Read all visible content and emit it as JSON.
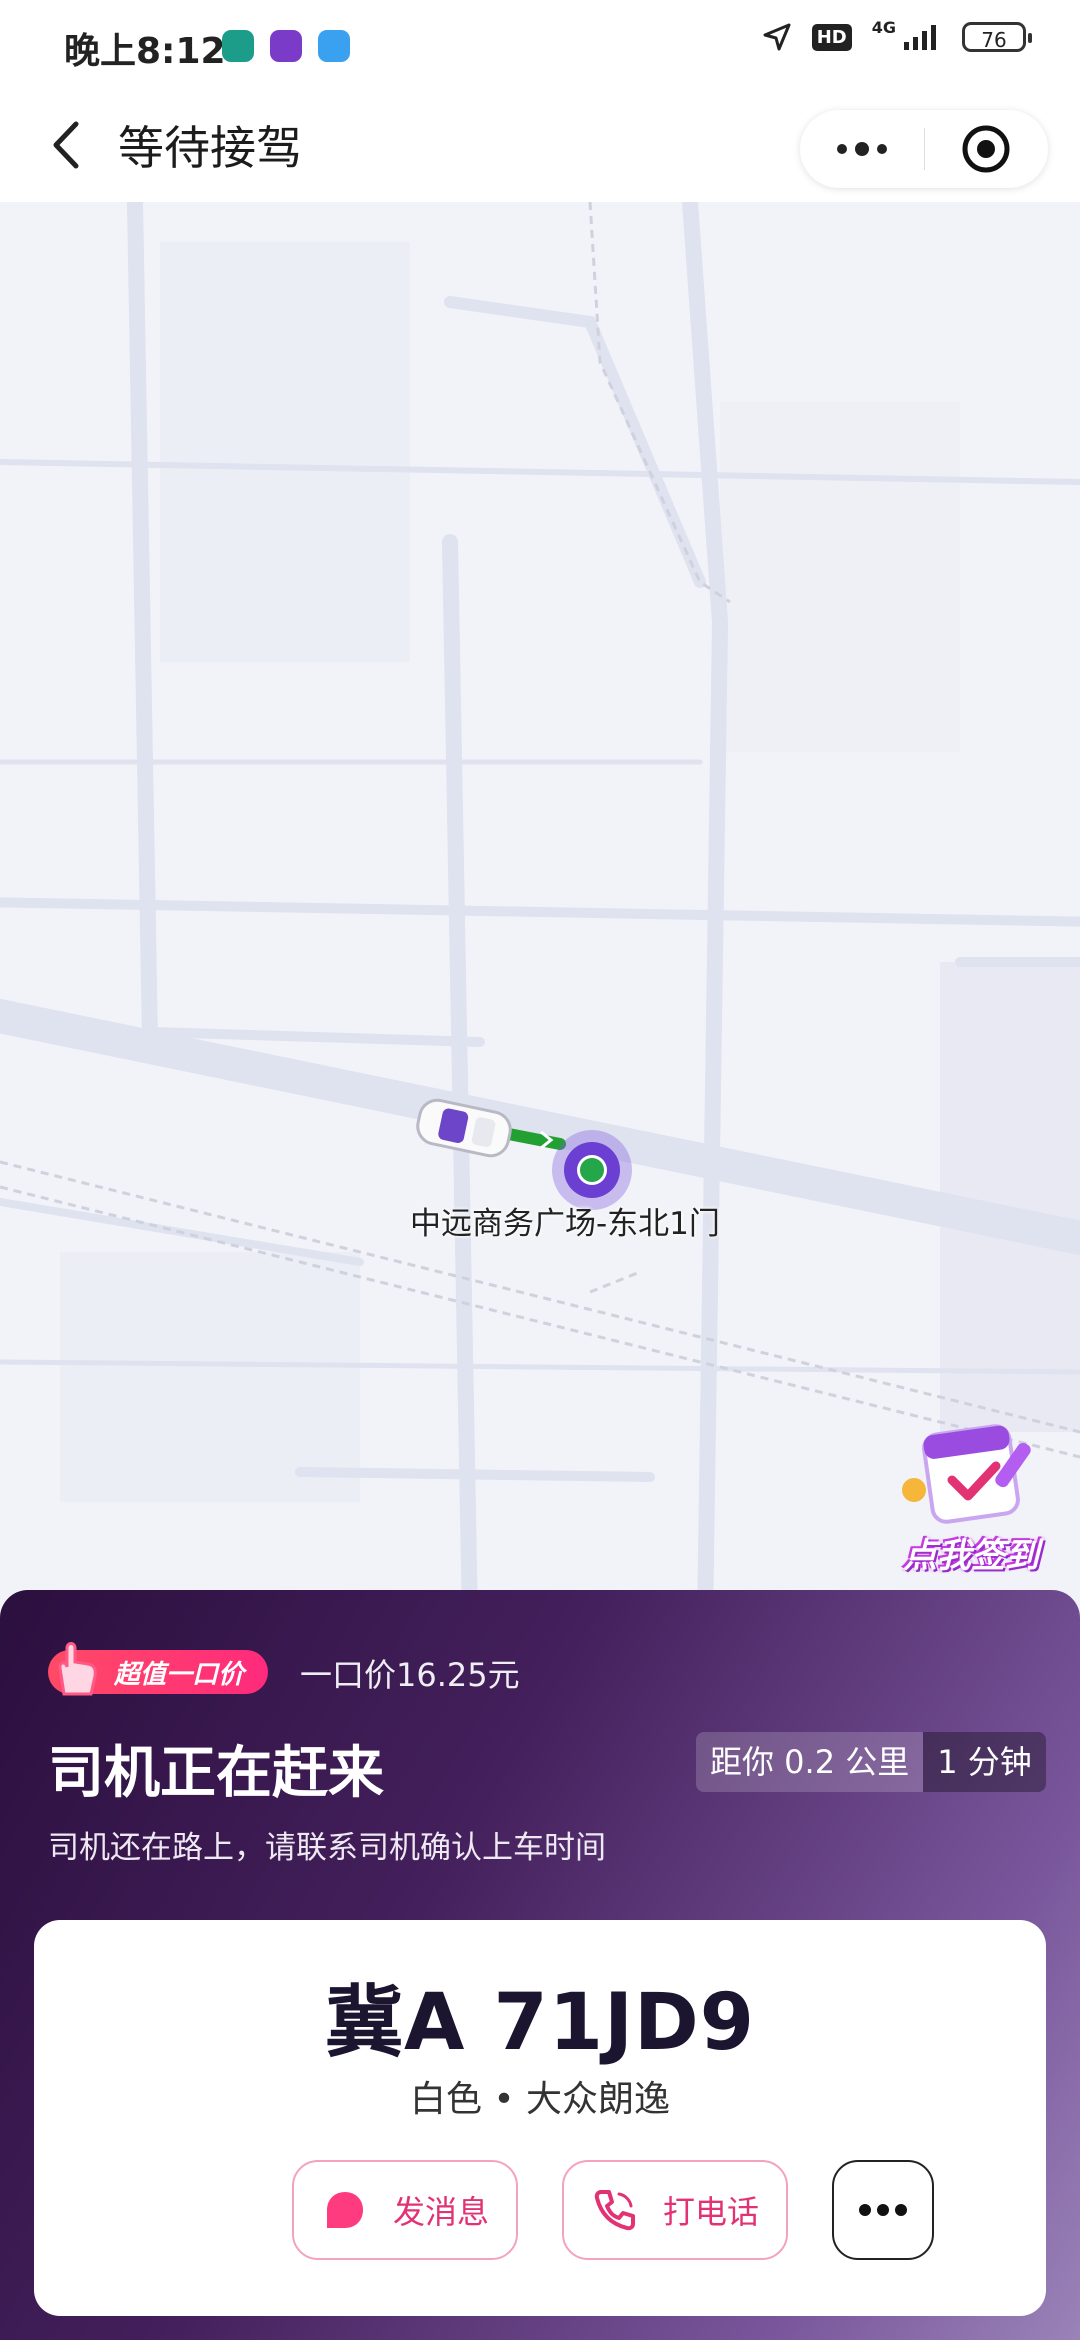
{
  "status_bar": {
    "time": "晚上8:12",
    "network": "4G",
    "hd": "HD",
    "battery": "76"
  },
  "header": {
    "title": "等待接驾"
  },
  "map": {
    "pickup_label": "中远商务广场-东北1门"
  },
  "signin": {
    "label": "点我签到"
  },
  "panel": {
    "badge": "超值一口价",
    "price": "一口价16.25元",
    "status_title": "司机正在赶来",
    "distance": "距你 0.2 公里",
    "eta": "1 分钟",
    "subtitle": "司机还在路上，请联系司机确认上车时间"
  },
  "car": {
    "plate": "冀A 71JD9",
    "description": "白色 • 大众朗逸"
  },
  "actions": {
    "message": "发消息",
    "call": "打电话"
  },
  "colors": {
    "accent_pink": "#e23273",
    "panel_dark": "#2b0f3e",
    "route_green": "#22a032",
    "pickup_purple": "#6a3fd1"
  }
}
